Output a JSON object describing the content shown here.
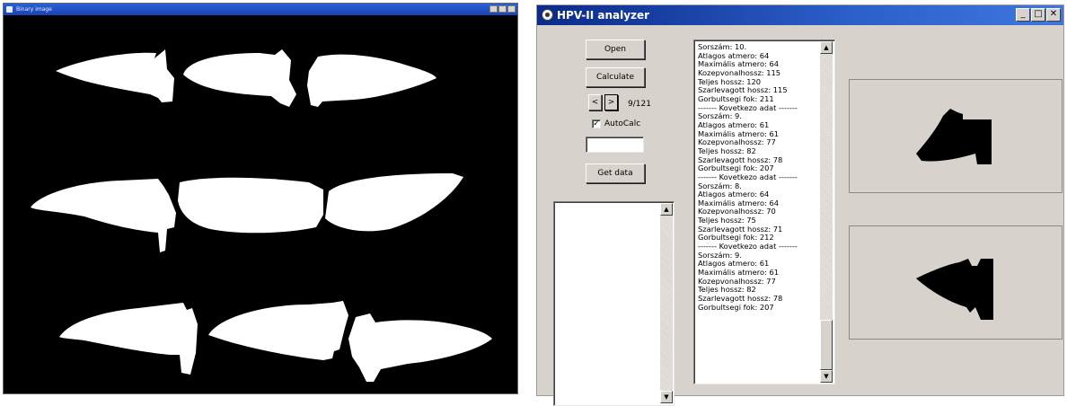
{
  "left_window": {
    "title": "Binary image"
  },
  "app": {
    "title": "HPV-II analyzer",
    "window_controls": {
      "minimize": "_",
      "maximize": "□",
      "close": "✕"
    }
  },
  "controls": {
    "open_label": "Open",
    "calculate_label": "Calculate",
    "prev_label": "<",
    "next_label": ">",
    "counter": "9/121",
    "autocalc_label": "AutoCalc",
    "autocalc_checked": true,
    "text_field_value": "",
    "get_data_label": "Get data"
  },
  "data_list": [
    "Sorszám: 10.",
    "Atlagos atmero: 64",
    "Maximális atmero: 64",
    "Kozepvonalhossz: 115",
    "Teljes hossz: 120",
    "Szarlevagott hossz: 115",
    "Gorbultsegi fok: 211",
    "------- Kovetkezo adat -------",
    "Sorszám: 9.",
    "Atlagos atmero: 61",
    "Maximális atmero: 61",
    "Kozepvonalhossz: 77",
    "Teljes hossz: 82",
    "Szarlevagott hossz: 78",
    "Gorbultsegi fok: 207",
    "------- Kovetkezo adat -------",
    "Sorszám: 8.",
    "Atlagos atmero: 64",
    "Maximális atmero: 64",
    "Kozepvonalhossz: 70",
    "Teljes hossz: 75",
    "Szarlevagott hossz: 71",
    "Gorbultsegi fok: 212",
    "------- Kovetkezo adat -------",
    "Sorszám: 9.",
    "Atlagos atmero: 61",
    "Maximális atmero: 61",
    "Kozepvonalhossz: 77",
    "Teljes hossz: 82",
    "Szarlevagott hossz: 78",
    "Gorbultsegi fok: 207"
  ],
  "icons": {
    "app_icon": "wheel-icon",
    "scroll_up": "▲",
    "scroll_down": "▼",
    "check": "✓"
  },
  "colors": {
    "title_bar_start": "#0b2a8a",
    "title_bar_end": "#3f77dd",
    "window_bg": "#d7d3cc",
    "binary_bg": "#000000",
    "binary_fg": "#ffffff"
  }
}
